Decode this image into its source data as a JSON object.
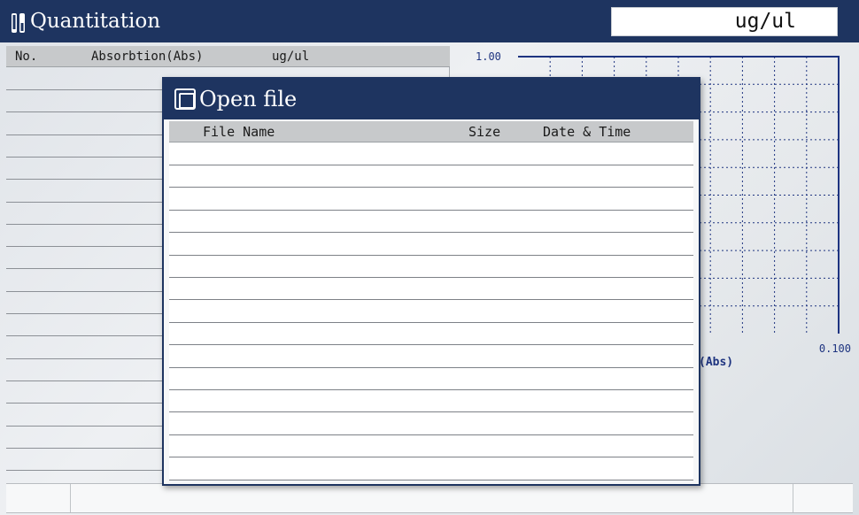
{
  "header": {
    "title": "Quantitation",
    "icon": "test-tubes-icon",
    "unit": "ug/ul"
  },
  "table": {
    "columns": [
      "No.",
      "Absorbtion(Abs)",
      "ug/ul"
    ]
  },
  "chart": {
    "y_top_label": "1.00",
    "x_right_label": "0.100",
    "x_axis_label": "(Abs)",
    "frame_color": "#1e3480",
    "grid_color": "#1e3480"
  },
  "dialog": {
    "title": "Open file",
    "icon": "chip-icon",
    "columns": {
      "name": "File Name",
      "size": "Size",
      "date": "Date & Time"
    }
  },
  "colors": {
    "titlebar": "#1e3460",
    "header_row": "#c7c9cb"
  }
}
